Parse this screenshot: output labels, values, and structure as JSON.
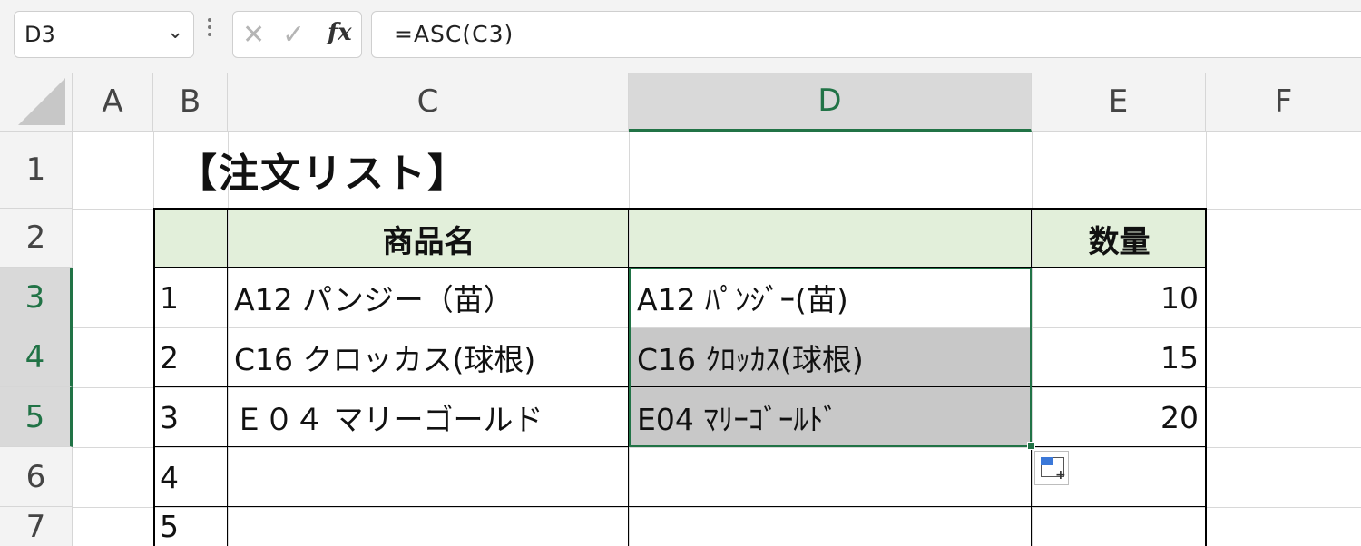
{
  "formula_bar": {
    "name_box": "D3",
    "cancel_glyph": "✕",
    "enter_glyph": "✓",
    "fx_label": "fx",
    "formula": "=ASC(C3)"
  },
  "columns": [
    "A",
    "B",
    "C",
    "D",
    "E",
    "F"
  ],
  "selected_column": "D",
  "rows": [
    "1",
    "2",
    "3",
    "4",
    "5",
    "6",
    "7"
  ],
  "selected_rows": [
    "3",
    "4",
    "5"
  ],
  "title": "【注文リスト】",
  "table": {
    "headers": {
      "b": "",
      "c": "商品名",
      "d": "",
      "e": "数量"
    },
    "rows": [
      {
        "no": "1",
        "name": "A12 パンジー（苗）",
        "converted": "A12 ﾊﾟﾝｼﾞｰ(苗)",
        "qty": "10"
      },
      {
        "no": "2",
        "name": "C16 クロッカス(球根)",
        "converted": "C16 ｸﾛｯｶｽ(球根)",
        "qty": "15"
      },
      {
        "no": "3",
        "name": "Ｅ０４ マリーゴールド",
        "converted": "E04 ﾏﾘｰｺﾞｰﾙﾄﾞ",
        "qty": "20"
      },
      {
        "no": "4",
        "name": "",
        "converted": "",
        "qty": ""
      },
      {
        "no": "5",
        "name": "",
        "converted": "",
        "qty": ""
      }
    ]
  },
  "colors": {
    "header_fill": "#e2efda",
    "selection": "#217346",
    "highlight_fill": "#c8c8c8"
  }
}
